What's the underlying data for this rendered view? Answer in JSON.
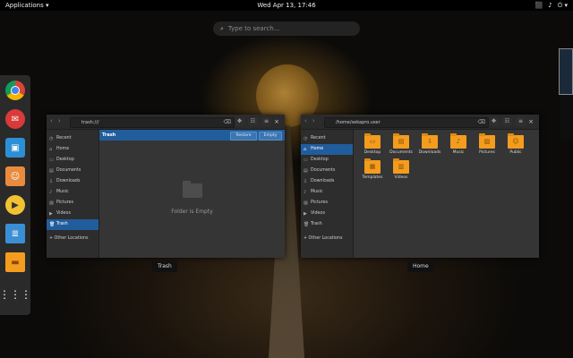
{
  "topbar": {
    "apps_label": "Applications ▾",
    "clock": "Wed Apr 13, 17:46",
    "tray": [
      "⬛",
      "♪",
      "⏻ ▾"
    ]
  },
  "search": {
    "placeholder": "Type to search..."
  },
  "dock": [
    "chrome-icon",
    "mail-icon",
    "store-icon",
    "contacts-icon",
    "music-player-icon",
    "documents-icon",
    "files-icon",
    "app-grid-icon"
  ],
  "trash_window": {
    "path": "trash:///",
    "sidebar": [
      "Recent",
      "Home",
      "Desktop",
      "Documents",
      "Downloads",
      "Music",
      "Pictures",
      "Videos",
      "Trash",
      "+ Other Locations"
    ],
    "active_index": 8,
    "bar_title": "Trash",
    "restore": "Restore",
    "empty": "Empty",
    "empty_text": "Folder is Empty",
    "label": "Trash"
  },
  "home_window": {
    "path": "/home/sekapro.user",
    "sidebar": [
      "Recent",
      "Home",
      "Desktop",
      "Documents",
      "Downloads",
      "Music",
      "Pictures",
      "Videos",
      "Trash",
      "+ Other Locations"
    ],
    "active_index": 1,
    "folders": [
      "Desktop",
      "Documents",
      "Downloads",
      "Music",
      "Pictures",
      "Public",
      "Templates",
      "Videos"
    ],
    "label": "Home"
  },
  "colors": {
    "accent": "#215d9c",
    "folder": "#f39c1e"
  }
}
